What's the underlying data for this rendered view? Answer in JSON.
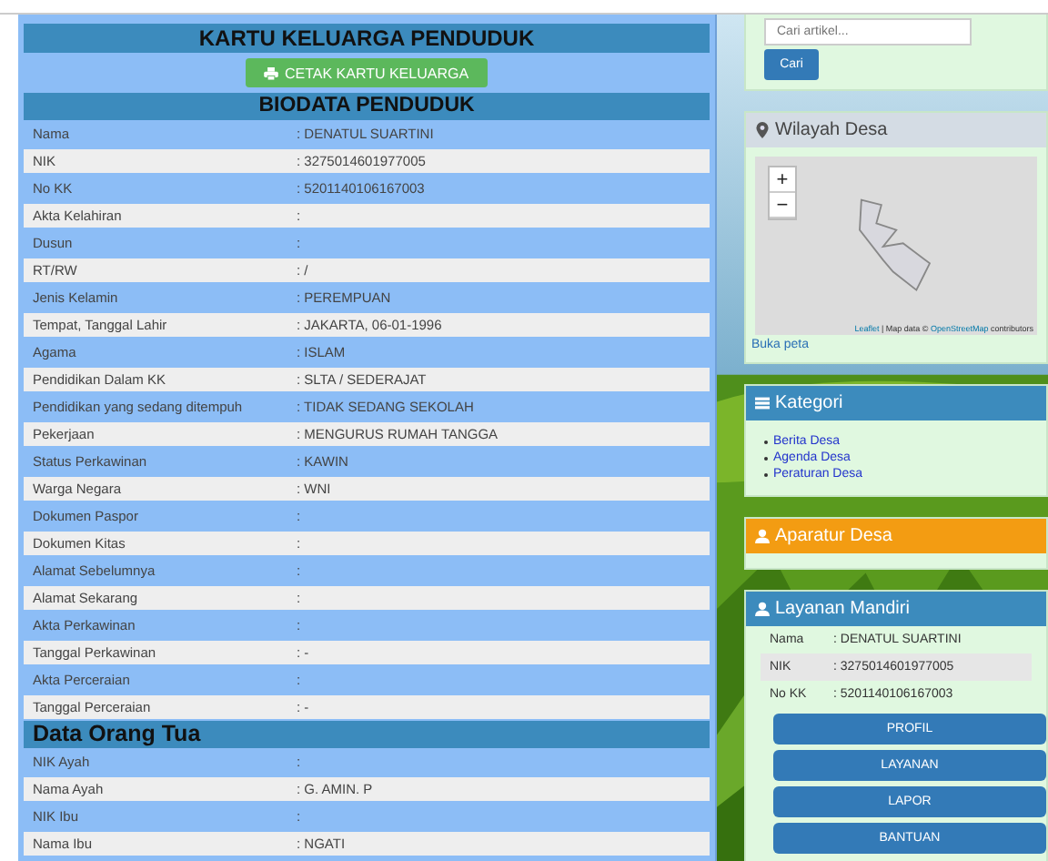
{
  "title": "KARTU KELUARGA PENDUDUK",
  "print_button": "CETAK KARTU KELUARGA",
  "sections": [
    {
      "heading": "BIODATA PENDUDUK",
      "kind": "centered",
      "rows": [
        {
          "label": "Nama",
          "value": ": DENATUL SUARTINI"
        },
        {
          "label": "NIK",
          "value": ": 3275014601977005"
        },
        {
          "label": "No KK",
          "value": ": 5201140106167003"
        },
        {
          "label": "Akta Kelahiran",
          "value": ":"
        },
        {
          "label": "Dusun",
          "value": ":"
        },
        {
          "label": "RT/RW",
          "value": ": /"
        },
        {
          "label": "Jenis Kelamin",
          "value": ": PEREMPUAN"
        },
        {
          "label": "Tempat, Tanggal Lahir",
          "value": ": JAKARTA, 06-01-1996"
        },
        {
          "label": "Agama",
          "value": ": ISLAM"
        },
        {
          "label": "Pendidikan Dalam KK",
          "value": ": SLTA / SEDERAJAT"
        },
        {
          "label": "Pendidikan yang sedang ditempuh",
          "value": ": TIDAK SEDANG SEKOLAH"
        },
        {
          "label": "Pekerjaan",
          "value": ": MENGURUS RUMAH TANGGA"
        },
        {
          "label": "Status Perkawinan",
          "value": ": KAWIN"
        },
        {
          "label": "Warga Negara",
          "value": ": WNI"
        },
        {
          "label": "Dokumen Paspor",
          "value": ":"
        },
        {
          "label": "Dokumen Kitas",
          "value": ":"
        },
        {
          "label": "Alamat Sebelumnya",
          "value": ":"
        },
        {
          "label": "Alamat Sekarang",
          "value": ":"
        },
        {
          "label": "Akta Perkawinan",
          "value": ":"
        },
        {
          "label": "Tanggal Perkawinan",
          "value": ": -"
        },
        {
          "label": "Akta Perceraian",
          "value": ":"
        },
        {
          "label": "Tanggal Perceraian",
          "value": ": -"
        }
      ]
    },
    {
      "heading": "Data Orang Tua",
      "kind": "left",
      "rows": [
        {
          "label": "NIK Ayah",
          "value": ":"
        },
        {
          "label": "Nama Ayah",
          "value": ": G. AMIN. P"
        },
        {
          "label": "NIK Ibu",
          "value": ":"
        },
        {
          "label": "Nama Ibu",
          "value": ": NGATI"
        }
      ]
    }
  ],
  "sidebar": {
    "search": {
      "placeholder": "Cari artikel...",
      "button": "Cari"
    },
    "wilayah": {
      "title": "Wilayah Desa",
      "zoom_in": "+",
      "zoom_out": "−",
      "attribution": [
        {
          "text": "Leaflet",
          "link": true
        },
        {
          "text": " | Map data © ",
          "link": false
        },
        {
          "text": "OpenStreetMap",
          "link": true
        },
        {
          "text": " contributors",
          "link": false
        }
      ],
      "open_link": "Buka peta"
    },
    "kategori": {
      "title": "Kategori",
      "items": [
        "Berita Desa",
        "Agenda Desa",
        "Peraturan Desa"
      ]
    },
    "aparatur": {
      "title": "Aparatur Desa"
    },
    "layanan": {
      "title": "Layanan Mandiri",
      "rows": [
        {
          "label": "Nama",
          "value": ": DENATUL SUARTINI"
        },
        {
          "label": "NIK",
          "value": ": 3275014601977005"
        },
        {
          "label": "No KK",
          "value": ": 5201140106167003"
        }
      ],
      "buttons": [
        "PROFIL",
        "LAYANAN",
        "LAPOR",
        "BANTUAN"
      ]
    }
  }
}
